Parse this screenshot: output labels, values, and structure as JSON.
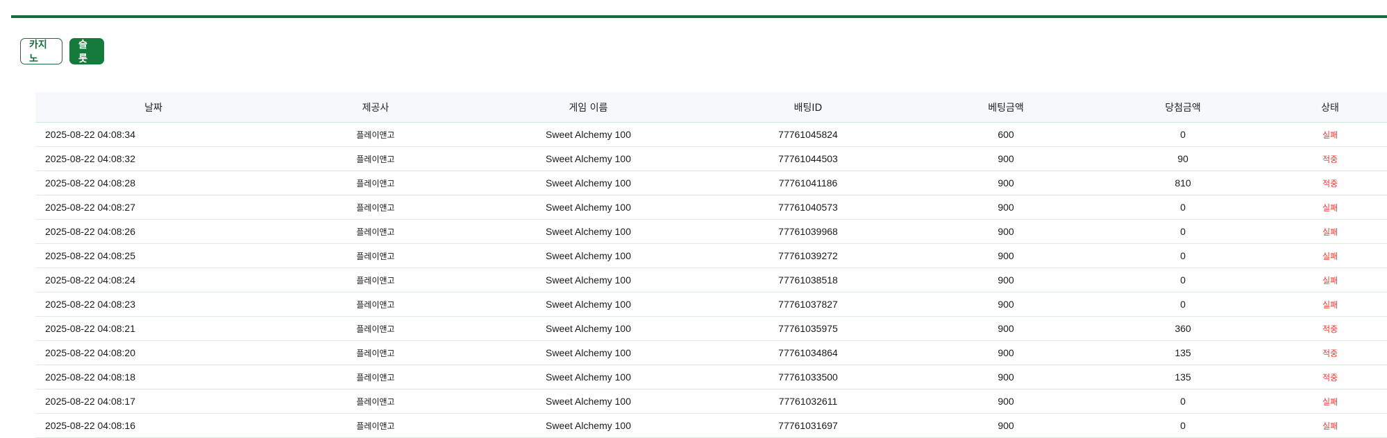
{
  "tabs": {
    "casino_label": "카지노",
    "slot_label": "슬롯",
    "active": "slot"
  },
  "colors": {
    "accent": "#1a6b3a",
    "active_tab": "#177a3d",
    "status_red": "#e53935"
  },
  "table": {
    "headers": [
      "날짜",
      "제공사",
      "게임 이름",
      "배팅ID",
      "베팅금액",
      "당첨금액",
      "상태"
    ],
    "rows": [
      {
        "date": "2025-08-22 04:08:34",
        "provider": "플레이앤고",
        "game": "Sweet Alchemy 100",
        "bet_id": "77761045824",
        "bet": "600",
        "win": "0",
        "status": "실패"
      },
      {
        "date": "2025-08-22 04:08:32",
        "provider": "플레이앤고",
        "game": "Sweet Alchemy 100",
        "bet_id": "77761044503",
        "bet": "900",
        "win": "90",
        "status": "적중"
      },
      {
        "date": "2025-08-22 04:08:28",
        "provider": "플레이앤고",
        "game": "Sweet Alchemy 100",
        "bet_id": "77761041186",
        "bet": "900",
        "win": "810",
        "status": "적중"
      },
      {
        "date": "2025-08-22 04:08:27",
        "provider": "플레이앤고",
        "game": "Sweet Alchemy 100",
        "bet_id": "77761040573",
        "bet": "900",
        "win": "0",
        "status": "실패"
      },
      {
        "date": "2025-08-22 04:08:26",
        "provider": "플레이앤고",
        "game": "Sweet Alchemy 100",
        "bet_id": "77761039968",
        "bet": "900",
        "win": "0",
        "status": "실패"
      },
      {
        "date": "2025-08-22 04:08:25",
        "provider": "플레이앤고",
        "game": "Sweet Alchemy 100",
        "bet_id": "77761039272",
        "bet": "900",
        "win": "0",
        "status": "실패"
      },
      {
        "date": "2025-08-22 04:08:24",
        "provider": "플레이앤고",
        "game": "Sweet Alchemy 100",
        "bet_id": "77761038518",
        "bet": "900",
        "win": "0",
        "status": "실패"
      },
      {
        "date": "2025-08-22 04:08:23",
        "provider": "플레이앤고",
        "game": "Sweet Alchemy 100",
        "bet_id": "77761037827",
        "bet": "900",
        "win": "0",
        "status": "실패"
      },
      {
        "date": "2025-08-22 04:08:21",
        "provider": "플레이앤고",
        "game": "Sweet Alchemy 100",
        "bet_id": "77761035975",
        "bet": "900",
        "win": "360",
        "status": "적중"
      },
      {
        "date": "2025-08-22 04:08:20",
        "provider": "플레이앤고",
        "game": "Sweet Alchemy 100",
        "bet_id": "77761034864",
        "bet": "900",
        "win": "135",
        "status": "적중"
      },
      {
        "date": "2025-08-22 04:08:18",
        "provider": "플레이앤고",
        "game": "Sweet Alchemy 100",
        "bet_id": "77761033500",
        "bet": "900",
        "win": "135",
        "status": "적중"
      },
      {
        "date": "2025-08-22 04:08:17",
        "provider": "플레이앤고",
        "game": "Sweet Alchemy 100",
        "bet_id": "77761032611",
        "bet": "900",
        "win": "0",
        "status": "실패"
      },
      {
        "date": "2025-08-22 04:08:16",
        "provider": "플레이앤고",
        "game": "Sweet Alchemy 100",
        "bet_id": "77761031697",
        "bet": "900",
        "win": "0",
        "status": "실패"
      }
    ]
  }
}
